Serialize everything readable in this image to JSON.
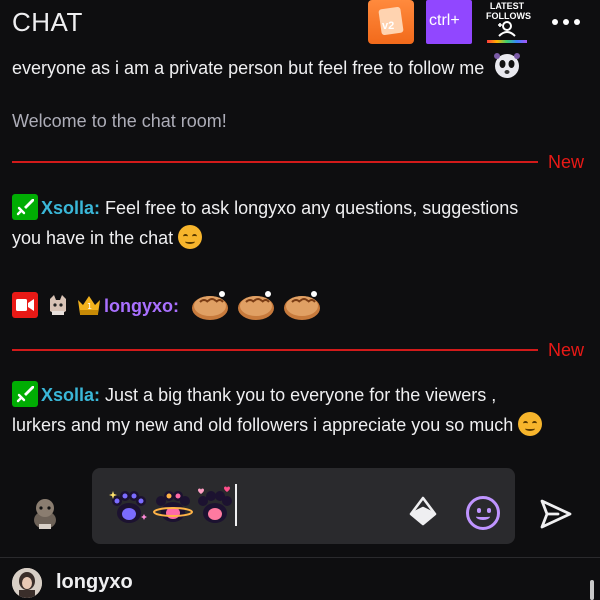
{
  "header": {
    "title": "CHAT",
    "extensions": {
      "v2_label": "v2",
      "ctrl_label": "ctrl+",
      "follows_label": "LATEST FOLLOWS"
    }
  },
  "chat": {
    "partial_line": "everyone as i am a private person but feel free to follow me",
    "welcome": "Welcome to the chat room!",
    "divider_label": "New",
    "messages": [
      {
        "user": "Xsolla",
        "role": "moderator",
        "text_line1": "Feel free to ask longyxo any questions, suggestions",
        "text_line2": "you have in the chat"
      },
      {
        "user": "longyxo",
        "role": "broadcaster",
        "emotes": [
          "bread-emote",
          "bread-emote",
          "bread-emote"
        ]
      },
      {
        "user": "Xsolla",
        "role": "moderator",
        "text_line1": "Just a big thank you to everyone for the viewers ,",
        "text_line2": "lurkers and my new and old followers i appreciate you so much"
      }
    ]
  },
  "input": {
    "emotes": [
      "paw-sparkle-emote",
      "paw-planet-emote",
      "paw-hearts-emote"
    ]
  },
  "footer": {
    "username": "longyxo"
  },
  "colors": {
    "moderator_name": "#3ab7d8",
    "broadcaster_name": "#a970ff",
    "new_divider": "#e91916",
    "accent": "#9147ff"
  }
}
